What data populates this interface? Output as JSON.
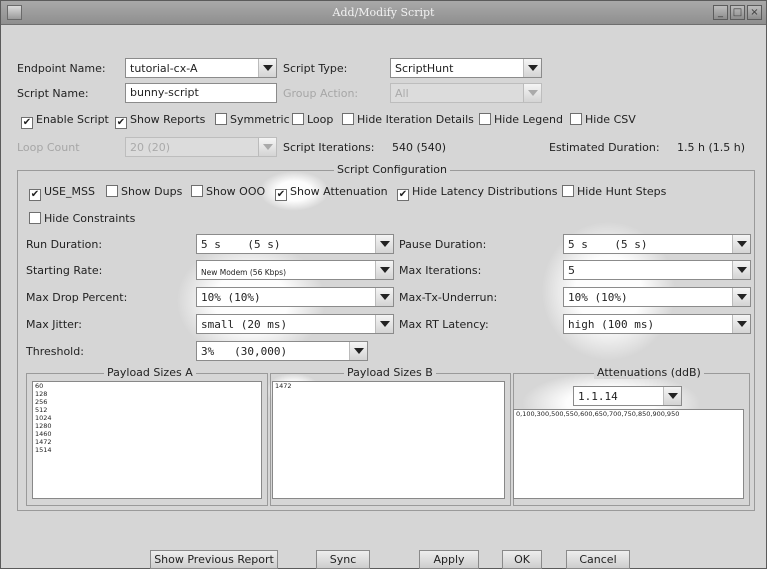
{
  "window": {
    "title": "Add/Modify Script"
  },
  "top": {
    "endpoint_name_label": "Endpoint Name:",
    "endpoint_name_value": "tutorial-cx-A",
    "script_type_label": "Script Type:",
    "script_type_value": "ScriptHunt",
    "script_name_label": "Script Name:",
    "script_name_value": "bunny-script",
    "group_action_label": "Group Action:",
    "group_action_value": "All",
    "loop_count_label": "Loop Count",
    "loop_count_value": "20 (20)",
    "script_iterations_label": "Script Iterations:",
    "script_iterations_value": "540 (540)",
    "estimated_duration_label": "Estimated Duration:",
    "estimated_duration_value": "1.5 h (1.5 h)"
  },
  "options": {
    "enable_script": "Enable Script",
    "show_reports": "Show Reports",
    "symmetric": "Symmetric",
    "loop": "Loop",
    "hide_iteration_details": "Hide Iteration Details",
    "hide_legend": "Hide Legend",
    "hide_csv": "Hide CSV"
  },
  "config": {
    "title": "Script Configuration",
    "checks": {
      "use_mss": "USE_MSS",
      "show_dups": "Show Dups",
      "show_ooo": "Show OOO",
      "show_attenuation": "Show Attenuation",
      "hide_latency": "Hide Latency Distributions",
      "hide_hunt_steps": "Hide Hunt Steps",
      "hide_constraints": "Hide Constraints"
    },
    "run_duration_label": "Run Duration:",
    "run_duration_value": "5 s    (5 s)",
    "pause_duration_label": "Pause Duration:",
    "pause_duration_value": "5 s    (5 s)",
    "starting_rate_label": "Starting Rate:",
    "starting_rate_value": "New Modem (56 Kbps)",
    "max_iterations_label": "Max Iterations:",
    "max_iterations_value": "5",
    "max_drop_label": "Max Drop Percent:",
    "max_drop_value": "10% (10%)",
    "max_tx_label": "Max-Tx-Underrun:",
    "max_tx_value": "10% (10%)",
    "max_jitter_label": "Max Jitter:",
    "max_jitter_value": "small (20 ms)",
    "max_rt_label": "Max RT Latency:",
    "max_rt_value": "high (100 ms)",
    "threshold_label": "Threshold:",
    "threshold_value": "3%   (30,000)"
  },
  "payload_a": {
    "title": "Payload Sizes A",
    "items": [
      "60",
      "128",
      "256",
      "512",
      "1024",
      "1280",
      "1460",
      "1472",
      "1514"
    ]
  },
  "payload_b": {
    "title": "Payload Sizes B",
    "items": [
      "1472"
    ]
  },
  "attenuations": {
    "title": "Attenuations (ddB)",
    "selector_value": "1.1.14",
    "values": "0,100,300,500,550,600,650,700,750,850,900,950"
  },
  "buttons": {
    "show_previous_report": "Show Previous Report",
    "sync": "Sync",
    "apply": "Apply",
    "ok": "OK",
    "cancel": "Cancel"
  }
}
